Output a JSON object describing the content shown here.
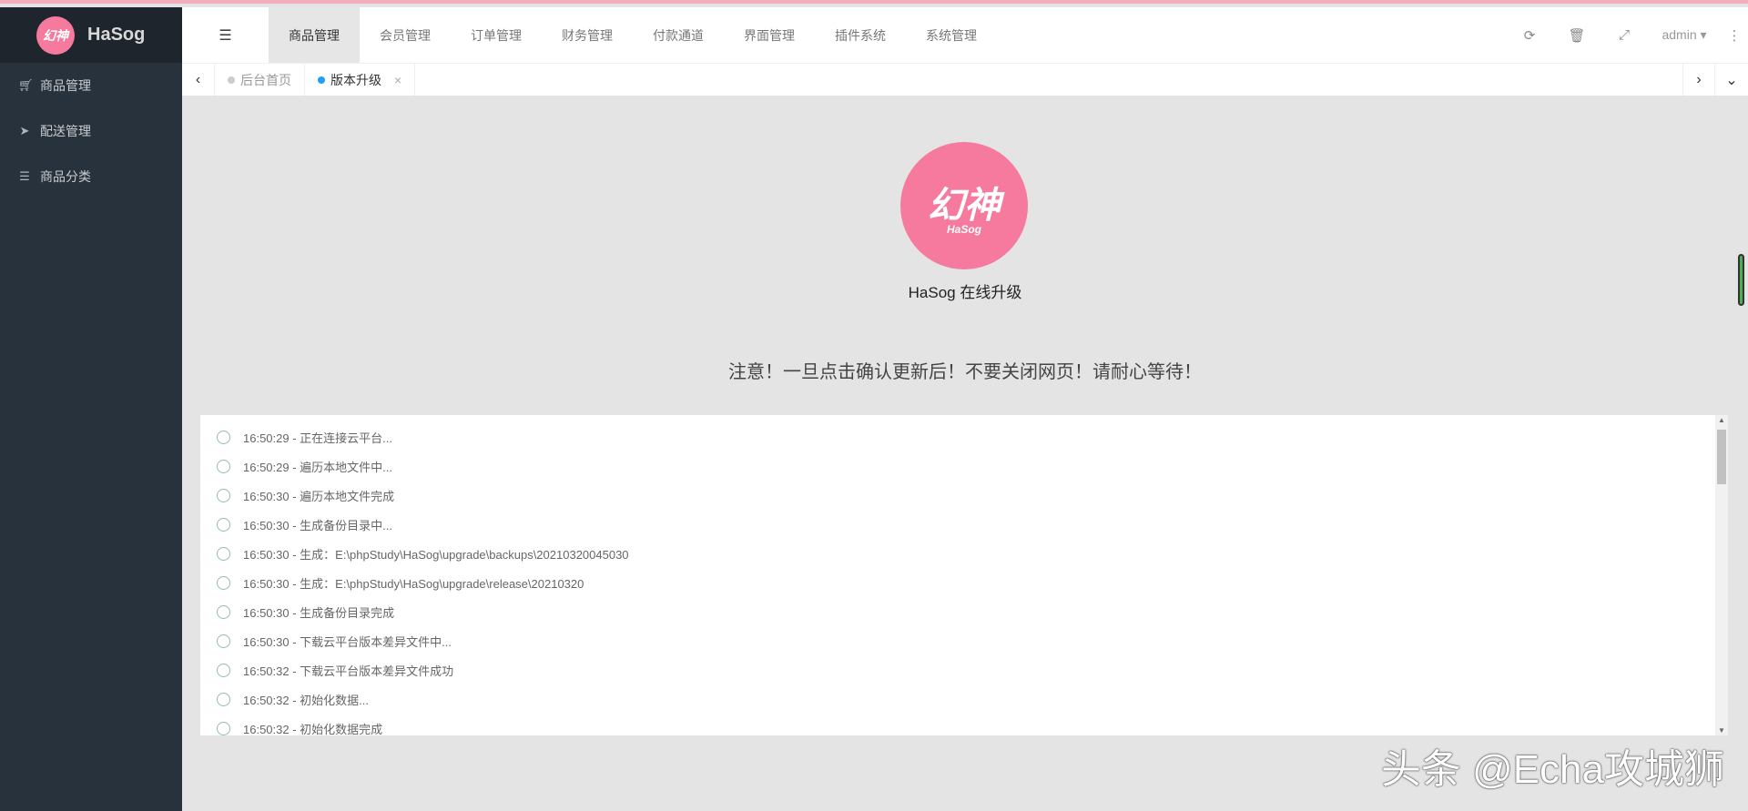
{
  "brand": {
    "name": "HaSog",
    "logo_text": "幻神"
  },
  "sidebar": {
    "items": [
      {
        "label": "商品管理",
        "icon": "cart-icon"
      },
      {
        "label": "配送管理",
        "icon": "paper-plane-icon"
      },
      {
        "label": "商品分类",
        "icon": "list-icon"
      }
    ]
  },
  "topnav": {
    "items": [
      "商品管理",
      "会员管理",
      "订单管理",
      "财务管理",
      "付款通道",
      "界面管理",
      "插件系统",
      "系统管理"
    ],
    "user": "admin"
  },
  "tabs": [
    {
      "label": "后台首页",
      "color": "#cccccc"
    },
    {
      "label": "版本升级",
      "color": "#1e9fff"
    }
  ],
  "main": {
    "logo_text": "幻神",
    "logo_sub": "HaSog",
    "title": "HaSog 在线升级",
    "notice": "注意！一旦点击确认更新后！不要关闭网页！请耐心等待！",
    "log": [
      "16:50:29 - 正在连接云平台...",
      "16:50:29 - 遍历本地文件中...",
      "16:50:30 - 遍历本地文件完成",
      "16:50:30 - 生成备份目录中...",
      "16:50:30 - 生成：E:\\phpStudy\\HaSog\\upgrade\\backups\\20210320045030",
      "16:50:30 - 生成：E:\\phpStudy\\HaSog\\upgrade\\release\\20210320",
      "16:50:30 - 生成备份目录完成",
      "16:50:30 - 下载云平台版本差异文件中...",
      "16:50:32 - 下载云平台版本差异文件成功",
      "16:50:32 - 初始化数据...",
      "16:50:32 - 初始化数据完成"
    ]
  },
  "watermark": "头条 @Echa攻城狮"
}
